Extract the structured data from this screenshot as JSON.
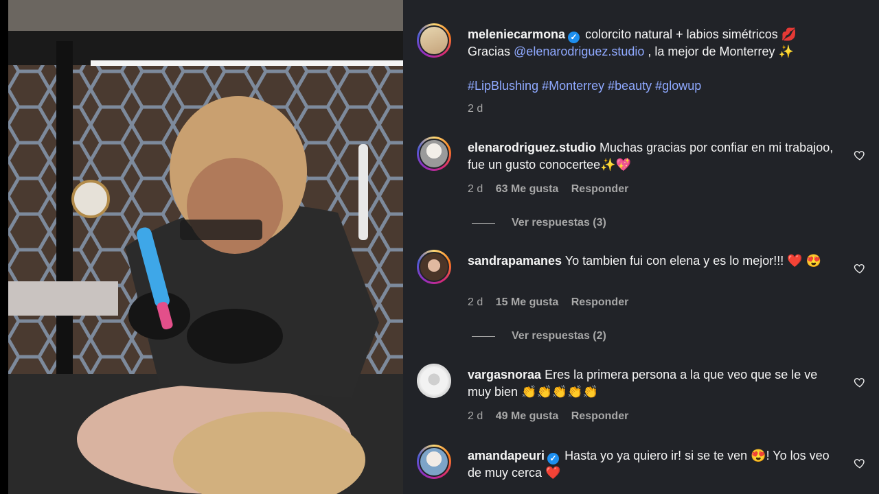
{
  "caption": {
    "username": "meleniecarmona",
    "verified": true,
    "line1": "colorcito natural + labios simétricos 💋",
    "line2_prefix": "Gracias ",
    "mention": "@elenarodriguez.studio",
    "line2_suffix": " , la mejor de Monterrey ✨",
    "hashtags": "#LipBlushing #Monterrey #beauty #glowup",
    "time": "2 d"
  },
  "comments": [
    {
      "username": "elenarodriguez.studio",
      "verified": false,
      "text": "Muchas gracias por confiar en mi trabajoo, fue un gusto conocertee✨💖",
      "time": "2 d",
      "likes": "63 Me gusta",
      "reply_label": "Responder",
      "view_replies": "Ver respuestas (3)"
    },
    {
      "username": "sandrapamanes",
      "verified": false,
      "text": "Yo tambien fui con elena y es lo mejor!!! ❤️ 😍",
      "time": "2 d",
      "likes": "15 Me gusta",
      "reply_label": "Responder",
      "view_replies": "Ver respuestas (2)"
    },
    {
      "username": "vargasnoraa",
      "verified": false,
      "text": "Eres la primera persona a la que veo que se le ve muy bien 👏👏👏👏👏",
      "time": "2 d",
      "likes": "49 Me gusta",
      "reply_label": "Responder"
    },
    {
      "username": "amandapeuri",
      "verified": true,
      "text": "Hasta yo ya quiero ir! si se te ven 😍! Yo los veo de muy cerca ❤️"
    }
  ],
  "icons": {
    "like": "heart-outline-icon",
    "verified": "verified-badge-icon"
  },
  "colors": {
    "panel_bg": "#212328",
    "link": "#8fa9ff",
    "muted": "#a8a8a8",
    "verified": "#1d8ff0"
  }
}
